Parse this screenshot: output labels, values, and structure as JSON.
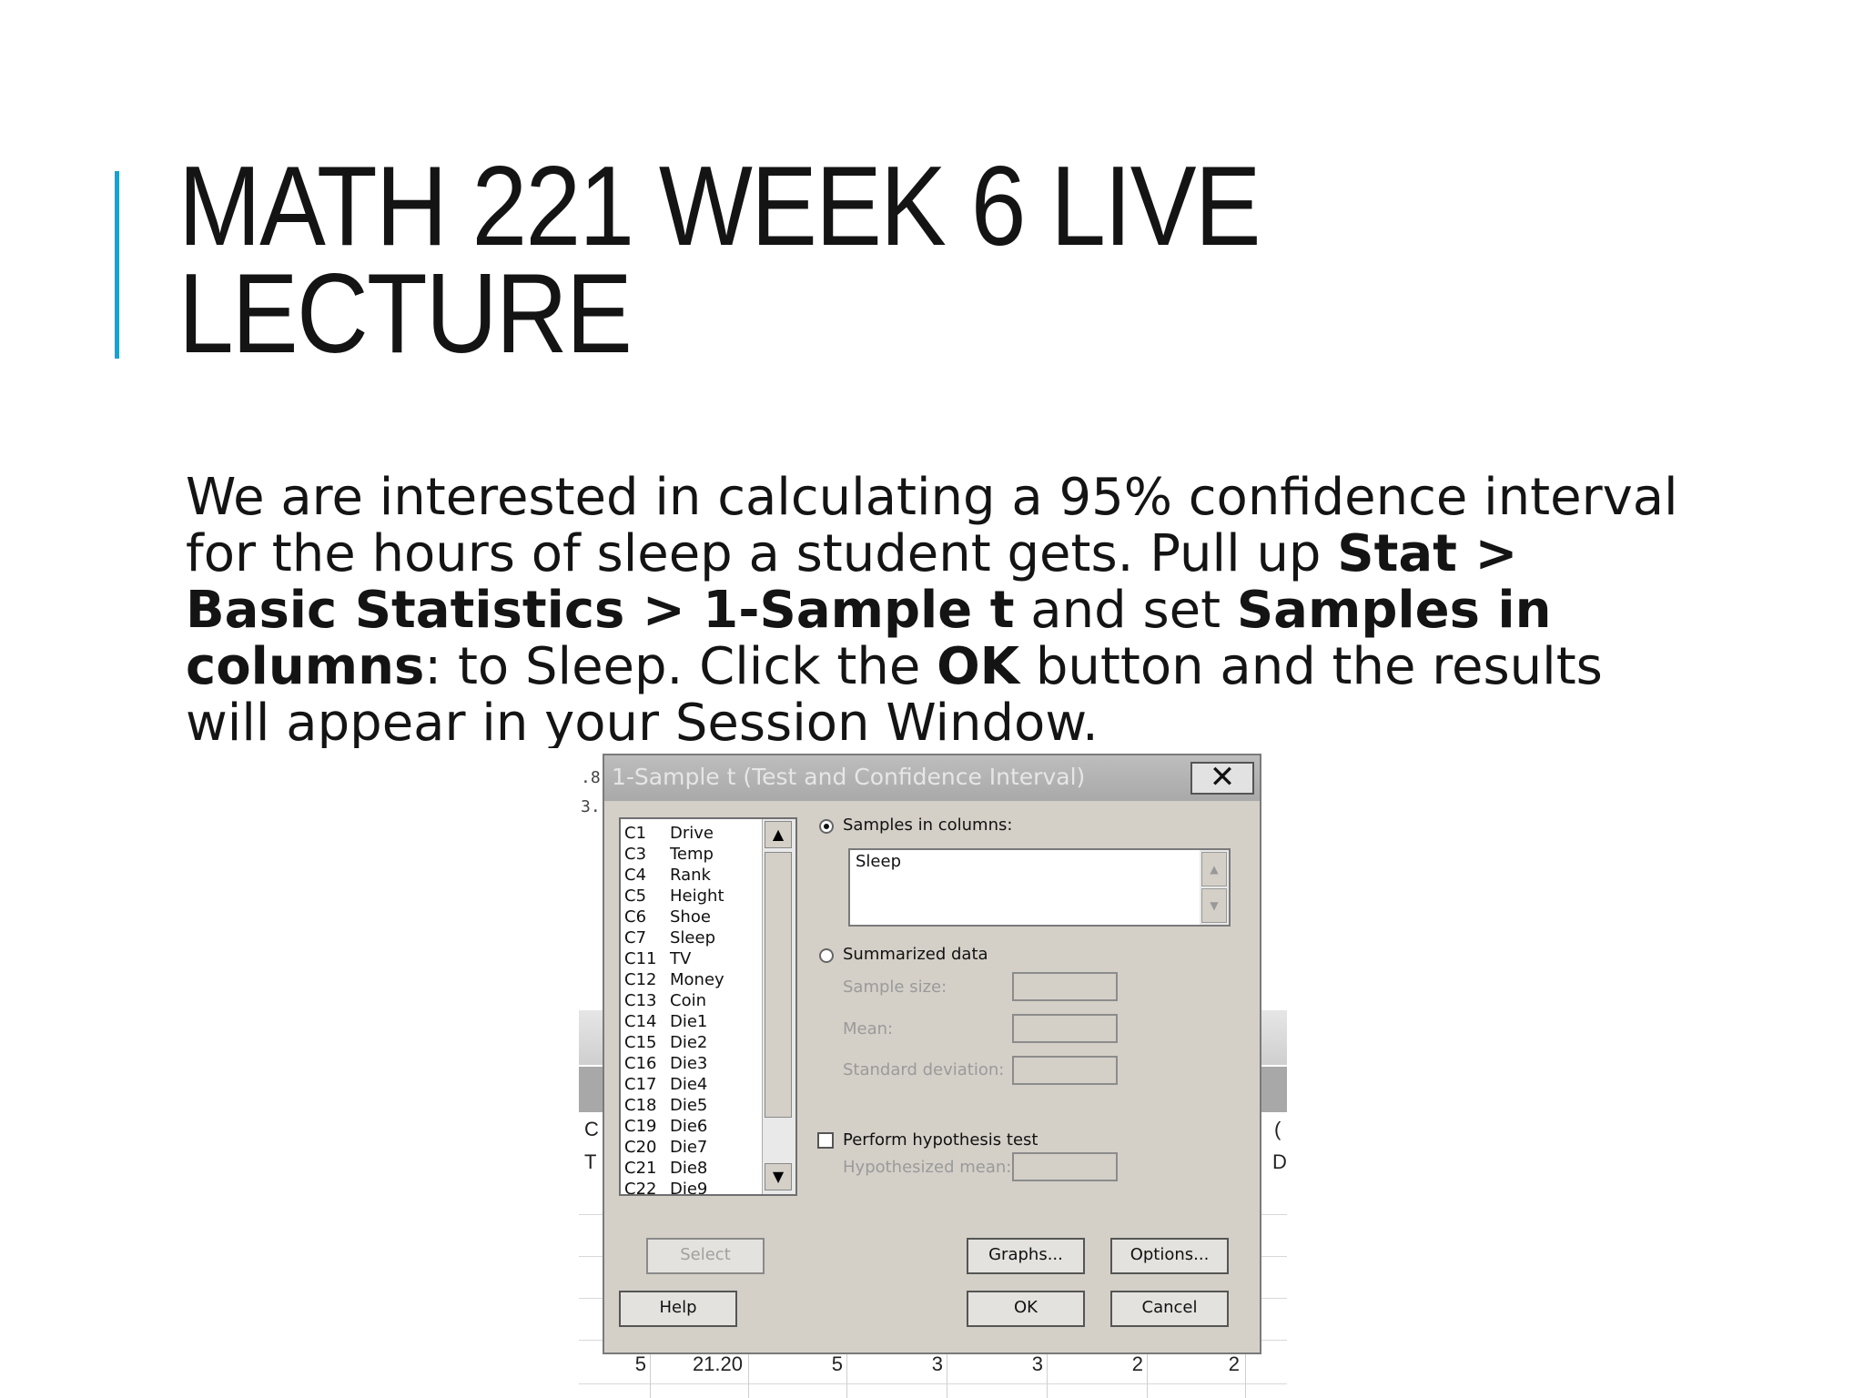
{
  "slide": {
    "title_line1": "MATH 221 WEEK 6 LIVE",
    "title_line2": "LECTURE",
    "body": {
      "t1": "We are interested in calculating a 95% confidence interval for the hours of sleep a student gets. Pull up ",
      "b1": "Stat > Basic Statistics > 1-Sample t",
      "t2": " and set ",
      "b2": "Samples in columns",
      "t3": ": to Sleep. Click the ",
      "b3": "OK",
      "t4": " button and the results will appear in your Session Window."
    }
  },
  "worksheet": {
    "top_fragment_1": ".8",
    "top_fragment_2": "3.",
    "left_header_1": "C",
    "left_header_2": "T",
    "right_header_1": "(",
    "right_header_2": "D",
    "row": [
      "5",
      "21.20",
      "5",
      "3",
      "3",
      "2",
      "2"
    ]
  },
  "dialog": {
    "title": "1-Sample t (Test and Confidence Interval)",
    "close_glyph": "✕",
    "columns": [
      {
        "id": "C1",
        "name": "Drive"
      },
      {
        "id": "C3",
        "name": "Temp"
      },
      {
        "id": "C4",
        "name": "Rank"
      },
      {
        "id": "C5",
        "name": "Height"
      },
      {
        "id": "C6",
        "name": "Shoe"
      },
      {
        "id": "C7",
        "name": "Sleep"
      },
      {
        "id": "C11",
        "name": "TV"
      },
      {
        "id": "C12",
        "name": "Money"
      },
      {
        "id": "C13",
        "name": "Coin"
      },
      {
        "id": "C14",
        "name": "Die1"
      },
      {
        "id": "C15",
        "name": "Die2"
      },
      {
        "id": "C16",
        "name": "Die3"
      },
      {
        "id": "C17",
        "name": "Die4"
      },
      {
        "id": "C18",
        "name": "Die5"
      },
      {
        "id": "C19",
        "name": "Die6"
      },
      {
        "id": "C20",
        "name": "Die7"
      },
      {
        "id": "C21",
        "name": "Die8"
      },
      {
        "id": "C22",
        "name": "Die9"
      }
    ],
    "samples_in_columns_label": "Samples in columns:",
    "samples_value": "Sleep",
    "summarized_label": "Summarized data",
    "sample_size_label": "Sample size:",
    "mean_label": "Mean:",
    "std_label": "Standard deviation:",
    "hypothesis_label": "Perform hypothesis test",
    "hypothesized_mean_label": "Hypothesized mean:",
    "select_button": "Select",
    "help_button": "Help",
    "graphs_button": "Graphs...",
    "options_button": "Options...",
    "ok_button": "OK",
    "cancel_button": "Cancel",
    "samples_in_columns_selected": true,
    "hypothesis_checked": false,
    "scroll_up_glyph": "▲",
    "scroll_down_glyph": "▼"
  },
  "colors": {
    "accent": "#1aa1d4",
    "dialog_bg": "#d4d0c8",
    "titlebar": "#a9a9a9"
  }
}
